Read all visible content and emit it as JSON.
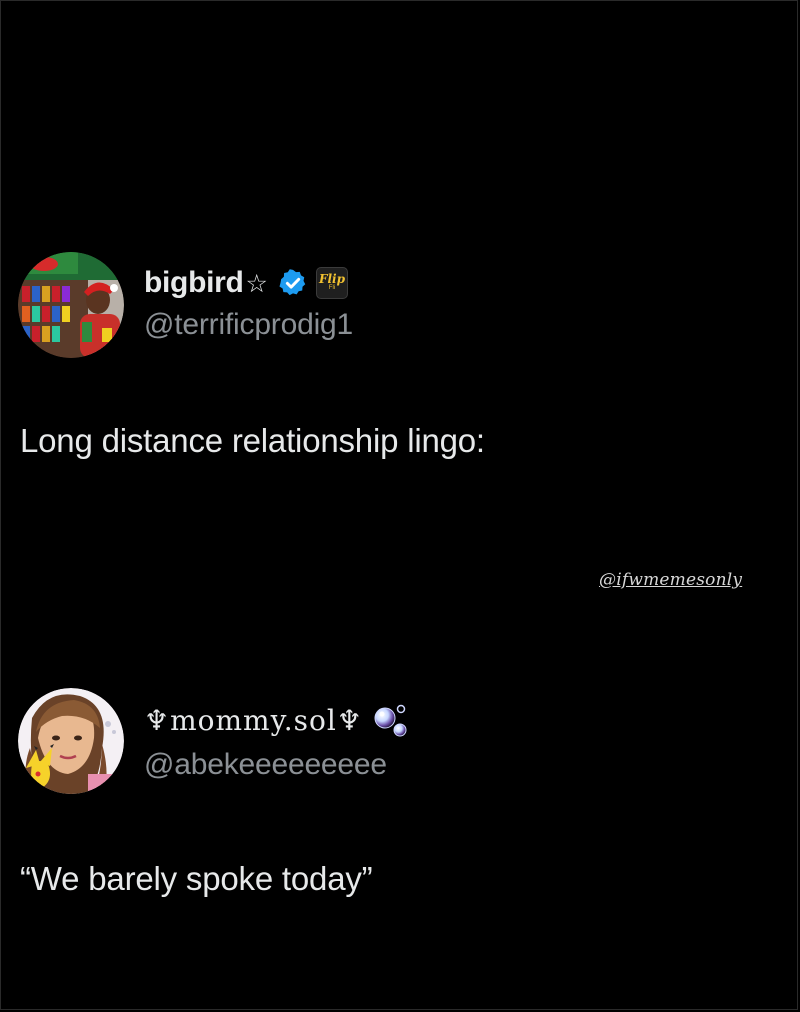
{
  "tweets": [
    {
      "display_name": "bigbird",
      "name_symbol": "☆",
      "verified": true,
      "badge": {
        "text": "Flip",
        "sub": "Fli"
      },
      "handle": "@terrificprodig1",
      "text": "Long distance relationship lingo:"
    },
    {
      "display_name": "♆mommy.sol♆",
      "handle": "@abekeeeeeeeee",
      "text": "“We barely spoke today”"
    }
  ],
  "watermark": "@ifwmemesonly",
  "colors": {
    "background": "#000000",
    "text_primary": "#e7e9ea",
    "text_secondary": "#8b9095",
    "verified_blue": "#1d9bf0",
    "badge_gold": "#f2c230"
  },
  "icons": {
    "verified": "verified-checkmark-icon",
    "badge": "flip-app-badge-icon",
    "emoji": "bubbles-icon"
  }
}
